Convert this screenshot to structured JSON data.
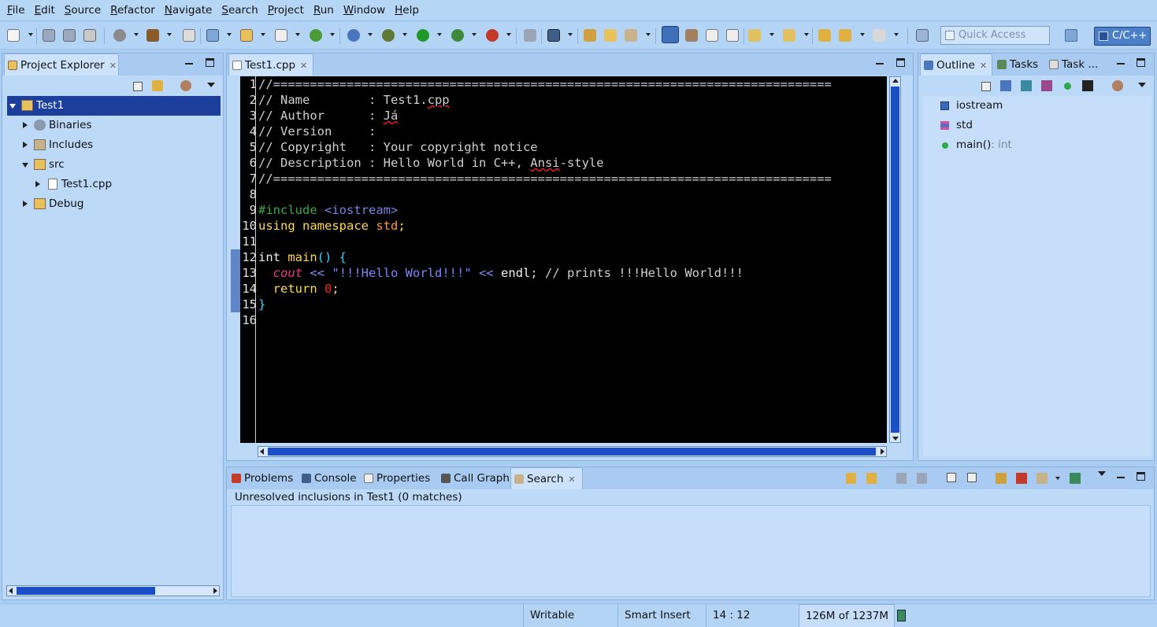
{
  "menu": [
    "File",
    "Edit",
    "Source",
    "Refactor",
    "Navigate",
    "Search",
    "Project",
    "Run",
    "Window",
    "Help"
  ],
  "toolbar": {
    "quick_access_placeholder": "Quick Access",
    "perspective": "C/C++"
  },
  "project_explorer": {
    "title": "Project Explorer",
    "tree": [
      {
        "label": "Test1",
        "level": 0,
        "expanded": true,
        "selected": true,
        "icon": "project-icon"
      },
      {
        "label": "Binaries",
        "level": 1,
        "expanded": false,
        "icon": "binaries-icon"
      },
      {
        "label": "Includes",
        "level": 1,
        "expanded": false,
        "icon": "includes-icon"
      },
      {
        "label": "src",
        "level": 1,
        "expanded": true,
        "icon": "folder-icon"
      },
      {
        "label": "Test1.cpp",
        "level": 2,
        "expanded": false,
        "icon": "cpp-file-icon"
      },
      {
        "label": "Debug",
        "level": 1,
        "expanded": false,
        "icon": "folder-icon"
      }
    ]
  },
  "editor": {
    "tab": "Test1.cpp",
    "line_numbers": [
      "1",
      "2",
      "3",
      "4",
      "5",
      "6",
      "7",
      "8",
      "9",
      "10",
      "11",
      "12",
      "13",
      "14",
      "15",
      "16"
    ]
  },
  "outline": {
    "tabs": [
      "Outline",
      "Tasks",
      "Task ..."
    ],
    "items": [
      {
        "label": "iostream",
        "type": "",
        "icon": "include-icon"
      },
      {
        "label": "std",
        "type": "",
        "icon": "namespace-icon"
      },
      {
        "label": "main()",
        "type": ": int",
        "icon": "function-icon"
      }
    ]
  },
  "bottom": {
    "tabs": [
      "Problems",
      "Console",
      "Properties",
      "Call Graph",
      "Search"
    ],
    "active_tab": "Search",
    "message": "Unresolved inclusions in Test1 (0 matches)"
  },
  "status": {
    "writable": "Writable",
    "insert_mode": "Smart Insert",
    "position": "14 : 12",
    "memory": "126M of 1237M"
  }
}
